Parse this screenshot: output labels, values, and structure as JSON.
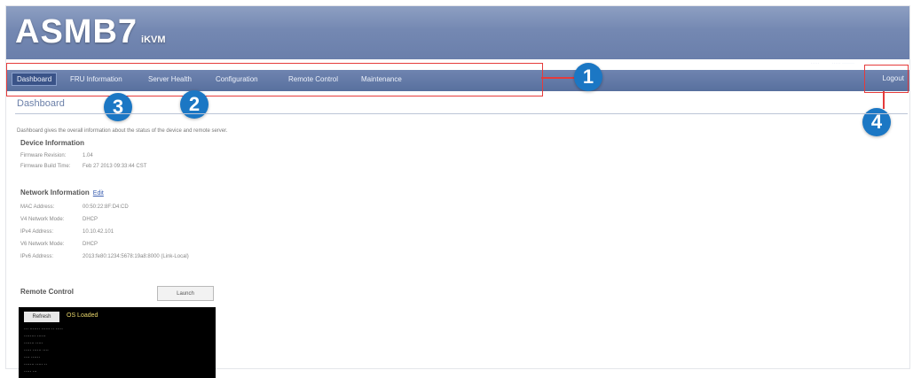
{
  "banner": {
    "logo": "ASMB7",
    "sub": "iKVM"
  },
  "toplinks": [
    "·····",
    "·····  ·······",
    "········",
    "······"
  ],
  "nav": {
    "items": [
      "Dashboard",
      "FRU Information",
      "Server Health",
      "Configuration",
      "Remote Control",
      "Maintenance"
    ],
    "logout": "Logout"
  },
  "callouts": {
    "c1": "1",
    "c2": "2",
    "c3": "3",
    "c4": "4"
  },
  "page": {
    "title": "Dashboard",
    "description": "Dashboard gives the overall information about the status of the device and remote server."
  },
  "device": {
    "heading": "Device Information",
    "rows": [
      {
        "label": "Firmware Revision:",
        "value": "1.04"
      },
      {
        "label": "Firmware Build Time:",
        "value": "Feb 27 2013 09:33:44 CST"
      }
    ]
  },
  "network": {
    "heading": "Network Information",
    "edit": "Edit",
    "rows": [
      {
        "label": "MAC Address:",
        "value": "00:50:22:8F:D4:CD"
      },
      {
        "label": "V4 Network Mode:",
        "value": "DHCP"
      },
      {
        "label": "IPv4 Address:",
        "value": "10.10.42.101"
      },
      {
        "label": "V6 Network Mode:",
        "value": "DHCP"
      },
      {
        "label": "IPv6 Address:",
        "value": "2013:fe80:1234:5678:19a8:8000 (Link-Local)"
      }
    ]
  },
  "remote": {
    "heading": "Remote Control",
    "launch": "Launch",
    "console_btn": "Refresh",
    "console_status": "OS Loaded",
    "console_lines": [
      "··· ······· ······   ·· ·····",
      "········ ······",
      "·······  ·····",
      "····· ······ ····",
      "···· ······",
      "······· ····· ··",
      "····· ···"
    ]
  }
}
